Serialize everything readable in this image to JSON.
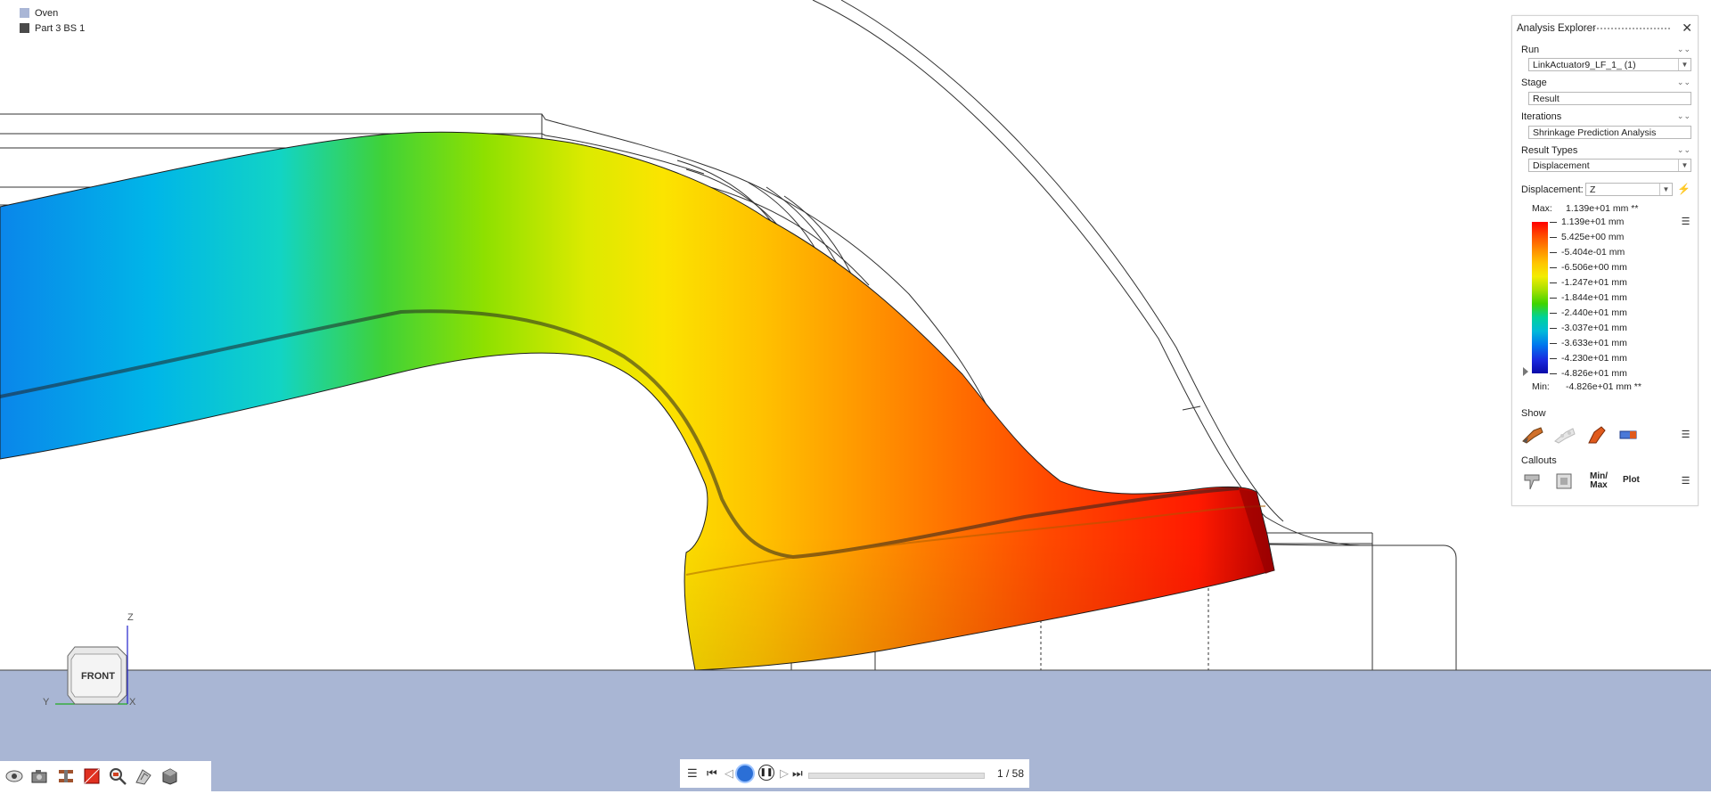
{
  "scene": {
    "legend": [
      {
        "label": "Oven",
        "color": "#a9b6d6"
      },
      {
        "label": "Part 3  BS 1",
        "color": "#4a4a4a"
      }
    ],
    "floor_color": "#a9b6d4",
    "view_cube": {
      "face": "FRONT",
      "axis_z": "Z",
      "axis_y": "Y",
      "axis_x": "X"
    }
  },
  "explorer": {
    "title": "Analysis Explorer",
    "run_label": "Run",
    "run_value": "LinkActuator9_LF_1_ (1)",
    "stage_label": "Stage",
    "stage_value": "Result",
    "iterations_label": "Iterations",
    "iterations_value": "Shrinkage Prediction Analysis",
    "result_types_label": "Result Types",
    "result_types_value": "Displacement",
    "component_label": "Displacement:",
    "component_value": "Z",
    "max_label": "Max:",
    "max_value": "1.139e+01 mm **",
    "min_label": "Min:",
    "min_value": "-4.826e+01 mm **",
    "scale": [
      "1.139e+01 mm",
      "5.425e+00 mm",
      "-5.404e-01 mm",
      "-6.506e+00 mm",
      "-1.247e+01 mm",
      "-1.844e+01 mm",
      "-2.440e+01 mm",
      "-3.037e+01 mm",
      "-3.633e+01 mm",
      "-4.230e+01 mm",
      "-4.826e+01 mm"
    ],
    "show_label": "Show",
    "callouts_label": "Callouts",
    "minmax_label": "Min/ Max",
    "plot_label": "Plot"
  },
  "animation": {
    "frame_counter": "1 / 58",
    "progress": 0.0
  },
  "view_toolbar_icons": [
    "eye-icon",
    "camera-icon",
    "section-cut-icon",
    "result-contour-icon",
    "zoom-fit-icon",
    "transparency-icon",
    "box-view-icon"
  ]
}
